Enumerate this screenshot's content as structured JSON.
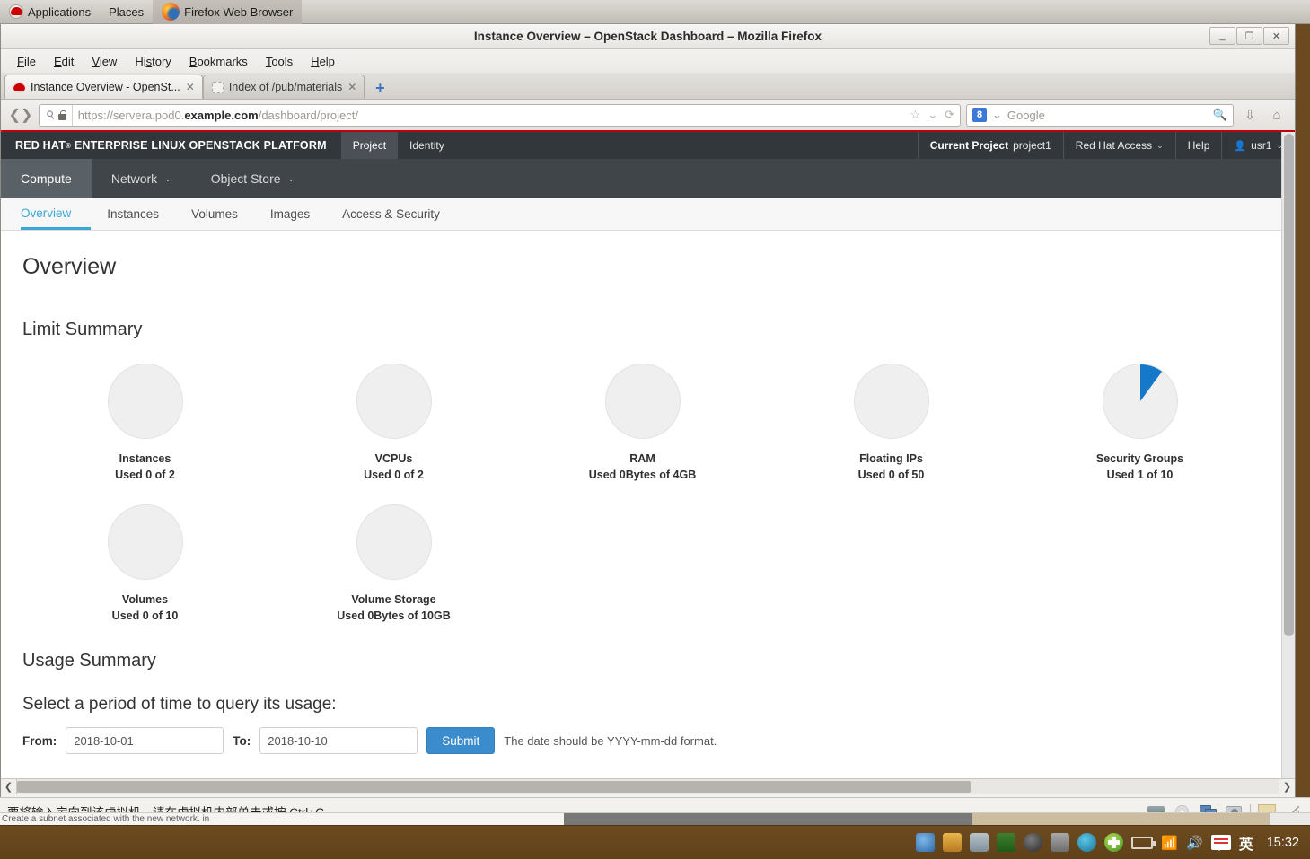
{
  "desktop": {
    "panel": {
      "applications": "Applications",
      "places": "Places",
      "active_window": "Firefox Web Browser"
    },
    "taskbar_clock": "15:32",
    "taskbar_ime": "英",
    "background_window_text": "Create a subnet associated with the new network. in"
  },
  "browser": {
    "window_title": "Instance Overview – OpenStack Dashboard – Mozilla Firefox",
    "window_buttons": {
      "minimize": "_",
      "maximize": "❐",
      "close": "✕"
    },
    "menus": [
      "File",
      "Edit",
      "View",
      "History",
      "Bookmarks",
      "Tools",
      "Help"
    ],
    "tabs": [
      {
        "title": "Instance Overview - OpenSt...",
        "active": true
      },
      {
        "title": "Index of /pub/materials",
        "active": false
      }
    ],
    "newtab_label": "+",
    "url": {
      "scheme": "https://",
      "host_pre": "servera.pod0.",
      "host_bold": "example.com",
      "path": "/dashboard/project/"
    },
    "search": {
      "engine": "8",
      "placeholder": "Google"
    }
  },
  "dashboard": {
    "brand": "RED HAT",
    "brand_sup": "®",
    "brand_rest": "ENTERPRISE LINUX OPENSTACK PLATFORM",
    "top_tabs": [
      {
        "label": "Project",
        "selected": true
      },
      {
        "label": "Identity",
        "selected": false
      }
    ],
    "top_right": {
      "current_project_label": "Current Project",
      "current_project_value": "project1",
      "red_hat_access": "Red Hat Access",
      "help": "Help",
      "user": "usr1"
    },
    "sub_nav": [
      {
        "label": "Compute",
        "selected": true,
        "caret": false
      },
      {
        "label": "Network",
        "selected": false,
        "caret": true
      },
      {
        "label": "Object Store",
        "selected": false,
        "caret": true
      }
    ],
    "panel_tabs": [
      {
        "label": "Overview",
        "selected": true
      },
      {
        "label": "Instances",
        "selected": false
      },
      {
        "label": "Volumes",
        "selected": false
      },
      {
        "label": "Images",
        "selected": false
      },
      {
        "label": "Access & Security",
        "selected": false
      }
    ],
    "page_title": "Overview",
    "limit_summary_title": "Limit Summary",
    "usage_summary_title": "Usage Summary",
    "usage_question": "Select a period of time to query its usage:",
    "form": {
      "from_label": "From:",
      "from_value": "2018-10-01",
      "to_label": "To:",
      "to_value": "2018-10-10",
      "submit_label": "Submit",
      "hint": "The date should be YYYY-mm-dd format."
    },
    "accent_blue": "#1678c8",
    "donut_gray": "#efefef"
  },
  "chart_data": [
    {
      "type": "pie",
      "title": "Instances",
      "subtitle": "Used 0 of 2",
      "used": 0,
      "limit": 2,
      "percent": 0,
      "slices": [
        {
          "name": "used",
          "value": 0,
          "color": "#1678c8"
        },
        {
          "name": "free",
          "value": 2,
          "color": "#efefef"
        }
      ]
    },
    {
      "type": "pie",
      "title": "VCPUs",
      "subtitle": "Used 0 of 2",
      "used": 0,
      "limit": 2,
      "percent": 0,
      "slices": [
        {
          "name": "used",
          "value": 0,
          "color": "#1678c8"
        },
        {
          "name": "free",
          "value": 2,
          "color": "#efefef"
        }
      ]
    },
    {
      "type": "pie",
      "title": "RAM",
      "subtitle": "Used 0Bytes of 4GB",
      "used": 0,
      "limit": 4,
      "percent": 0,
      "slices": [
        {
          "name": "used",
          "value": 0,
          "color": "#1678c8"
        },
        {
          "name": "free",
          "value": 4,
          "color": "#efefef"
        }
      ]
    },
    {
      "type": "pie",
      "title": "Floating IPs",
      "subtitle": "Used 0 of 50",
      "used": 0,
      "limit": 50,
      "percent": 0,
      "slices": [
        {
          "name": "used",
          "value": 0,
          "color": "#1678c8"
        },
        {
          "name": "free",
          "value": 50,
          "color": "#efefef"
        }
      ]
    },
    {
      "type": "pie",
      "title": "Security Groups",
      "subtitle": "Used 1 of 10",
      "used": 1,
      "limit": 10,
      "percent": 10,
      "slices": [
        {
          "name": "used",
          "value": 1,
          "color": "#1678c8"
        },
        {
          "name": "free",
          "value": 9,
          "color": "#efefef"
        }
      ]
    },
    {
      "type": "pie",
      "title": "Volumes",
      "subtitle": "Used 0 of 10",
      "used": 0,
      "limit": 10,
      "percent": 0,
      "slices": [
        {
          "name": "used",
          "value": 0,
          "color": "#1678c8"
        },
        {
          "name": "free",
          "value": 10,
          "color": "#efefef"
        }
      ]
    },
    {
      "type": "pie",
      "title": "Volume Storage",
      "subtitle": "Used 0Bytes of 10GB",
      "used": 0,
      "limit": 10,
      "percent": 0,
      "slices": [
        {
          "name": "used",
          "value": 0,
          "color": "#1678c8"
        },
        {
          "name": "free",
          "value": 10,
          "color": "#efefef"
        }
      ]
    }
  ],
  "vm_status": {
    "message": "要将输入定向到该虚拟机，请在虚拟机内部单击或按 Ctrl+G。"
  }
}
